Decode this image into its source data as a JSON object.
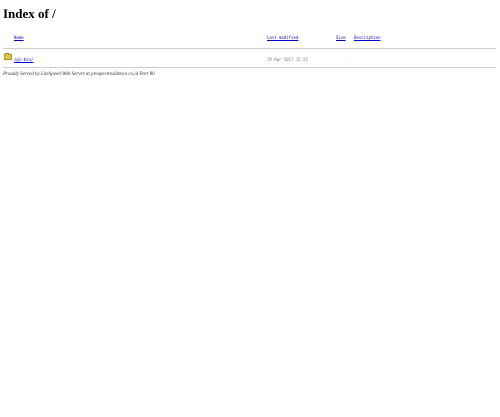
{
  "page": {
    "title": "Index of /"
  },
  "table": {
    "headers": {
      "name": "Name",
      "last_modified": "Last modified",
      "size": "Size",
      "description": "Description"
    },
    "rows": [
      {
        "icon": "folder-icon",
        "name": "cgi-bin/",
        "last_modified": "19-Apr-2017 15:22",
        "size": "-",
        "description": ""
      }
    ]
  },
  "footer": {
    "text": "Proudly Served by LiteSpeed Web Server at prospectresidence.co.id Port 80"
  },
  "colors": {
    "link": "#0000cc",
    "folder": "#d9c547",
    "rule": "#cfcfcf"
  }
}
